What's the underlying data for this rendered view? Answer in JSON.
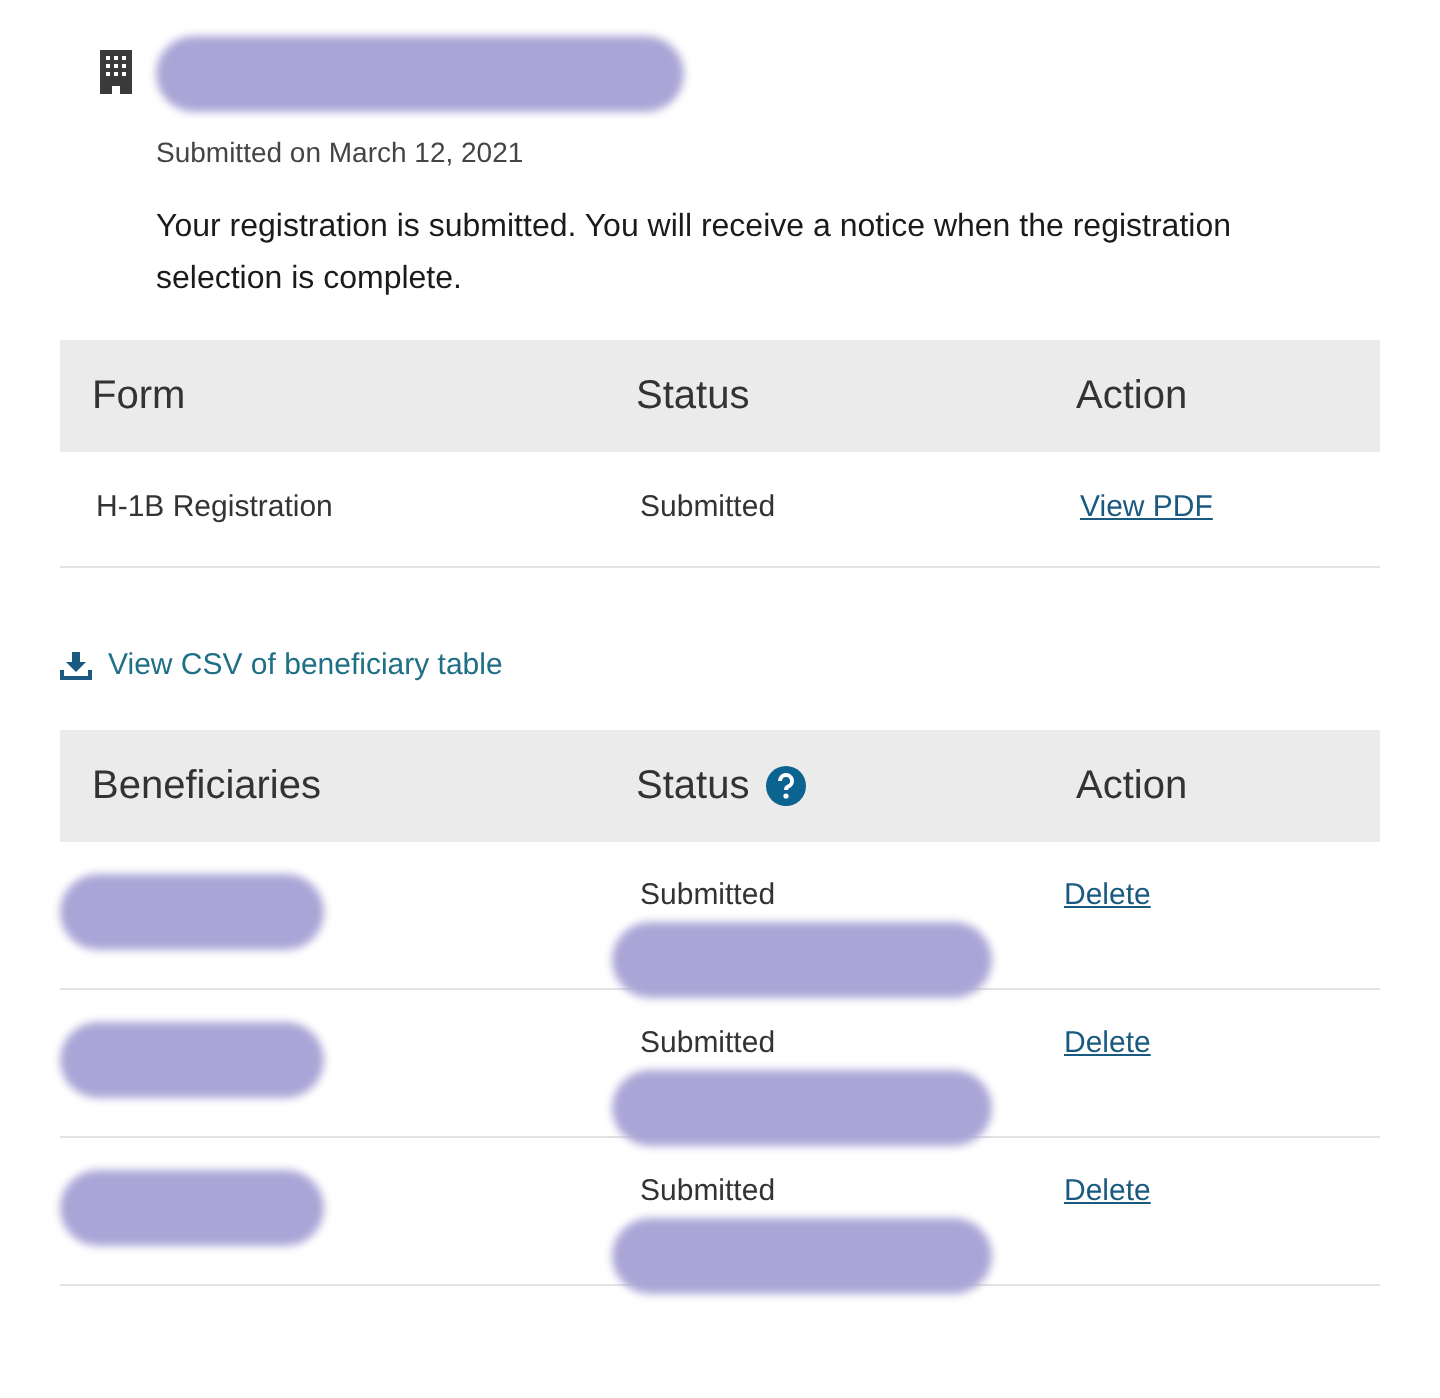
{
  "header": {
    "title_redacted": true,
    "submitted_date": "Submitted on March 12, 2021",
    "message": "Your registration is submitted. You will receive a notice when the registration selection is complete."
  },
  "form_table": {
    "columns": [
      "Form",
      "Status",
      "Action"
    ],
    "rows": [
      {
        "form": "H-1B Registration",
        "status": "Submitted",
        "action": "View PDF"
      }
    ]
  },
  "csv_link": "View CSV of beneficiary table",
  "beneficiary_table": {
    "columns": [
      "Beneficiaries",
      "Status",
      "Action"
    ],
    "rows": [
      {
        "beneficiary_redacted": true,
        "status": "Submitted",
        "status_detail_redacted": true,
        "action": "Delete"
      },
      {
        "beneficiary_redacted": true,
        "status": "Submitted",
        "status_detail_redacted": true,
        "action": "Delete"
      },
      {
        "beneficiary_redacted": true,
        "status": "Submitted",
        "status_detail_redacted": true,
        "action": "Delete"
      }
    ]
  }
}
